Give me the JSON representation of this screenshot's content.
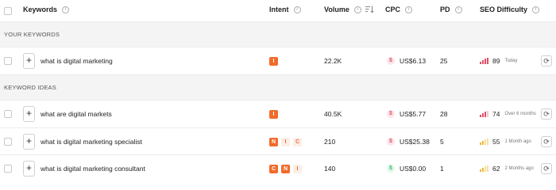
{
  "header": {
    "keywords": "Keywords",
    "intent": "Intent",
    "volume": "Volume",
    "cpc": "CPC",
    "pd": "PD",
    "seo_difficulty": "SEO Difficulty"
  },
  "sections": {
    "your_keywords": "YOUR KEYWORDS",
    "keyword_ideas": "KEYWORD IDEAS"
  },
  "icons": {
    "info": "i",
    "plus": "+",
    "dollar": "$",
    "refresh": "⟳",
    "sort": "sort-icon"
  },
  "colors": {
    "intent_strong_bg": "#f26b2a",
    "intent_strong_text": "#ffffff",
    "intent_weak_bg": "#fdeee6",
    "intent_weak_text": "#e86a3a",
    "cpc_red": "#e05a6a",
    "cpc_red_bg": "#fde6ea",
    "cpc_green": "#3cbf7a",
    "cpc_green_bg": "#e3f7ec",
    "sd_red": "#e34d6a",
    "sd_yellow": "#f0b72f"
  },
  "rows": [
    {
      "keyword": "what is digital marketing",
      "intents": [
        "I"
      ],
      "volume": "22.2K",
      "cpc": "US$6.13",
      "pd": "25",
      "sd": "89",
      "updated": "Today"
    },
    {
      "keyword": "what are digital markets",
      "intents": [
        "I"
      ],
      "volume": "40.5K",
      "cpc": "US$5.77",
      "pd": "28",
      "sd": "74",
      "updated": "Over 6 months"
    },
    {
      "keyword": "what is digital marketing specialist",
      "intents": [
        "N",
        "I",
        "C"
      ],
      "volume": "210",
      "cpc": "US$25.38",
      "pd": "5",
      "sd": "55",
      "updated": "1 Month ago"
    },
    {
      "keyword": "what is digital marketing consultant",
      "intents": [
        "C",
        "N",
        "I"
      ],
      "volume": "140",
      "cpc": "US$0.00",
      "pd": "1",
      "sd": "62",
      "updated": "2 Months ago"
    }
  ]
}
